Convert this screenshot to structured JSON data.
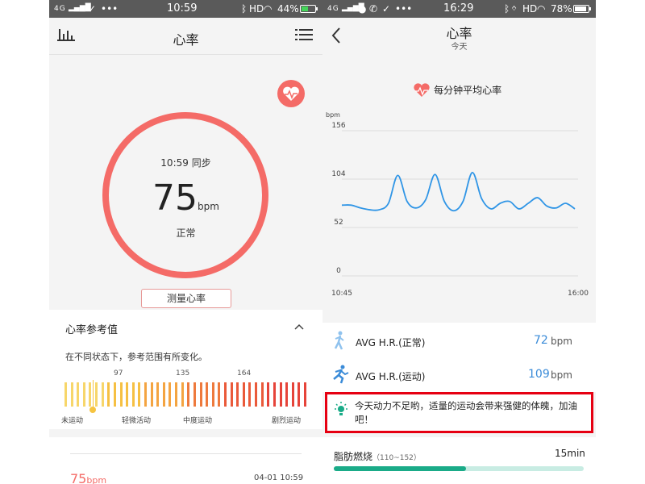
{
  "left": {
    "status": {
      "network": "4G",
      "time": "10:59",
      "indicators": "HD",
      "battery": "44%",
      "battery_level": 0.44
    },
    "title": "心率",
    "gauge": {
      "sync_text": "10:59 同步",
      "value": "75",
      "unit": "bpm",
      "state": "正常"
    },
    "measure_button": "测量心率",
    "reference": {
      "title": "心率参考值",
      "description": "在不同状态下，参考范围有所变化。",
      "thresholds": [
        "97",
        "135",
        "164"
      ],
      "zones": [
        "未运动",
        "轻微活动",
        "中度运动",
        "剧烈运动"
      ],
      "marker_value": 75
    },
    "record": {
      "value": "75",
      "unit": "bpm",
      "date": "04-01 10:59"
    }
  },
  "right": {
    "status": {
      "network": "4G",
      "time": "16:29",
      "indicators": "HD",
      "battery": "78%",
      "battery_level": 0.78
    },
    "title": "心率",
    "subtitle": "今天",
    "chart_title": "每分钟平均心率",
    "chart_data": {
      "type": "line",
      "title": "每分钟平均心率",
      "ylabel": "bpm",
      "xlabel": "",
      "x_ticks": [
        "10:45",
        "16:00"
      ],
      "y_ticks": [
        "0",
        "52",
        "104",
        "156"
      ],
      "ylim": [
        0,
        156
      ],
      "grid": true,
      "series": [
        {
          "values": [
            76,
            76,
            73,
            71,
            71,
            78,
            108,
            80,
            73,
            82,
            109,
            80,
            70,
            80,
            111,
            83,
            72,
            78,
            80,
            72,
            78,
            84,
            75,
            73,
            78,
            72
          ]
        }
      ]
    },
    "stats": [
      {
        "label": "AVG H.R.(正常)",
        "value": "72",
        "unit": "bpm",
        "icon": "walking-icon",
        "color": "#3a8bd8"
      },
      {
        "label": "AVG H.R.(运动)",
        "value": "109",
        "unit": "bpm",
        "icon": "running-icon",
        "color": "#3a8bd8"
      }
    ],
    "tip": "今天动力不足哟，适量的运动会带来强健的体魄，加油吧！",
    "fat_burn": {
      "label": "脂肪燃烧",
      "range": "（110~152）",
      "duration": "15min",
      "progress": 0.53
    }
  },
  "colors": {
    "accent": "#f46b67",
    "chart_line": "#2f95e6",
    "tip_border": "#e60012",
    "progress": "#1aab88"
  }
}
